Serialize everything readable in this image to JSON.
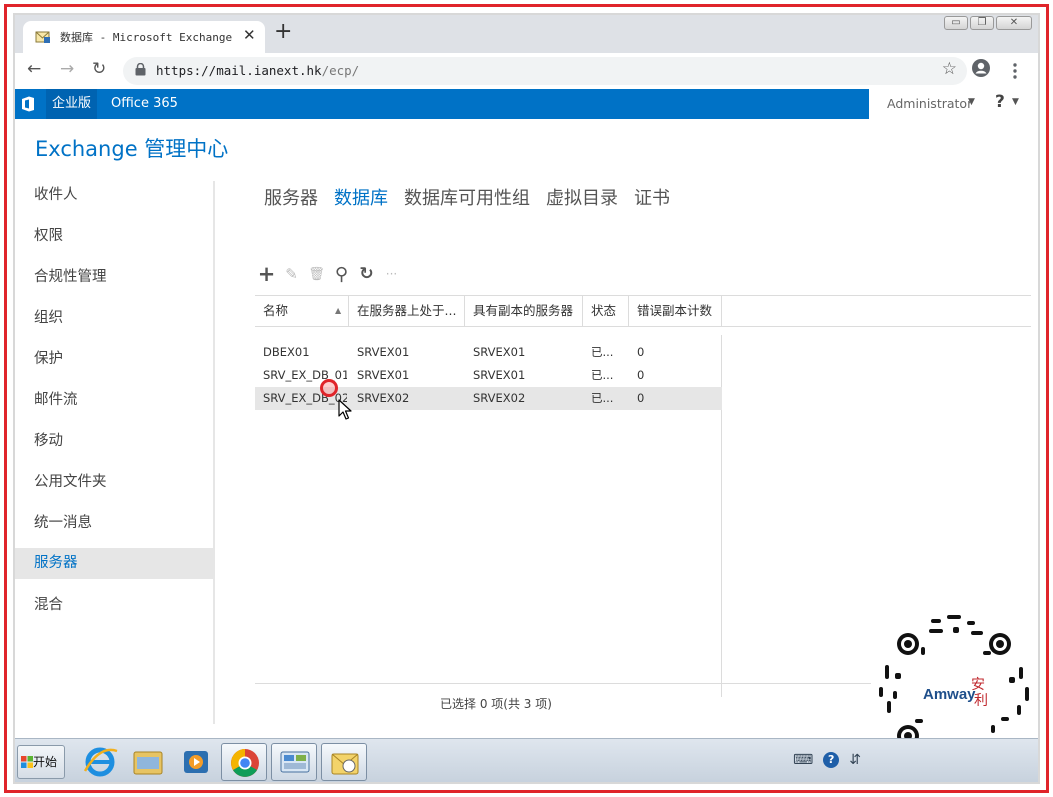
{
  "browser": {
    "tab_title": "数据库 - Microsoft Exchange",
    "tab_close": "✕",
    "new_tab": "+",
    "url_host": "https://mail.ianext.hk",
    "url_path": "/ecp/",
    "window_controls": [
      "▭",
      "❐",
      "✕"
    ]
  },
  "o365bar": {
    "brand": "企业版",
    "product": "Office 365",
    "user": "Administrator",
    "help": "?"
  },
  "ecp": {
    "title": "Exchange 管理中心",
    "nav": [
      {
        "label": "收件人",
        "active": false
      },
      {
        "label": "权限",
        "active": false
      },
      {
        "label": "合规性管理",
        "active": false
      },
      {
        "label": "组织",
        "active": false
      },
      {
        "label": "保护",
        "active": false
      },
      {
        "label": "邮件流",
        "active": false
      },
      {
        "label": "移动",
        "active": false
      },
      {
        "label": "公用文件夹",
        "active": false
      },
      {
        "label": "统一消息",
        "active": false
      },
      {
        "label": "服务器",
        "active": true
      },
      {
        "label": "混合",
        "active": false
      }
    ],
    "subtabs": [
      {
        "label": "服务器",
        "active": false
      },
      {
        "label": "数据库",
        "active": true
      },
      {
        "label": "数据库可用性组",
        "active": false
      },
      {
        "label": "虚拟目录",
        "active": false
      },
      {
        "label": "证书",
        "active": false
      }
    ],
    "toolbar": {
      "add": "+",
      "edit": "✎",
      "delete": "🗑",
      "search": "⚲",
      "refresh": "↻",
      "more": "···"
    },
    "grid": {
      "columns": [
        "名称",
        "在服务器上处于...",
        "具有副本的服务器",
        "状态",
        "错误副本计数"
      ],
      "sort_indicator": "▲",
      "rows": [
        {
          "name": "DBEX01",
          "server": "SRVEX01",
          "copies": "SRVEX01",
          "status": "已...",
          "errors": "0",
          "selected": false
        },
        {
          "name": "SRV_EX_DB_01",
          "server": "SRVEX01",
          "copies": "SRVEX01",
          "status": "已...",
          "errors": "0",
          "selected": false
        },
        {
          "name": "SRV_EX_DB_02",
          "server": "SRVEX02",
          "copies": "SRVEX02",
          "status": "已...",
          "errors": "0",
          "selected": true
        }
      ]
    },
    "footer": "已选择 0 项(共 3 项)"
  },
  "taskbar": {
    "start": "开始",
    "tray_icons": [
      "keyboard-icon",
      "help-icon",
      "network-icon"
    ]
  },
  "colors": {
    "accent": "#0072c6",
    "frame_border": "#e0242a"
  }
}
